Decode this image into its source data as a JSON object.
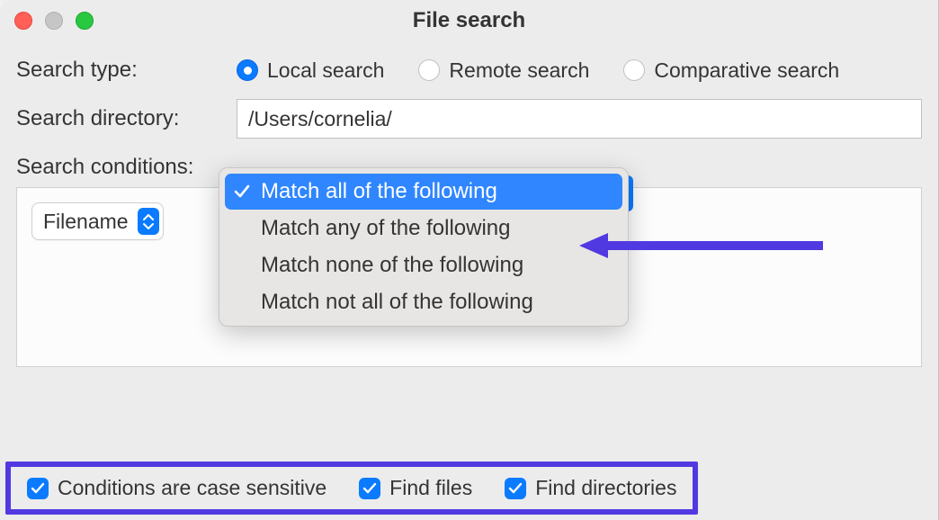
{
  "window": {
    "title": "File search"
  },
  "labels": {
    "search_type": "Search type:",
    "search_directory": "Search directory:",
    "search_conditions": "Search conditions:"
  },
  "search_types": {
    "local": "Local search",
    "remote": "Remote search",
    "comparative": "Comparative search",
    "selected": "local"
  },
  "directory": {
    "value": "/Users/cornelia/"
  },
  "condition_match": {
    "options": [
      "Match all of the following",
      "Match any of the following",
      "Match none of the following",
      "Match not all of the following"
    ],
    "selected_index": 0
  },
  "filter_field": {
    "label": "Filename"
  },
  "checks": {
    "case_sensitive": {
      "label": "Conditions are case sensitive",
      "checked": true
    },
    "find_files": {
      "label": "Find files",
      "checked": true
    },
    "find_dirs": {
      "label": "Find directories",
      "checked": true
    }
  },
  "colors": {
    "accent_blue": "#0a7bff",
    "annotation_purple": "#5139e1"
  }
}
